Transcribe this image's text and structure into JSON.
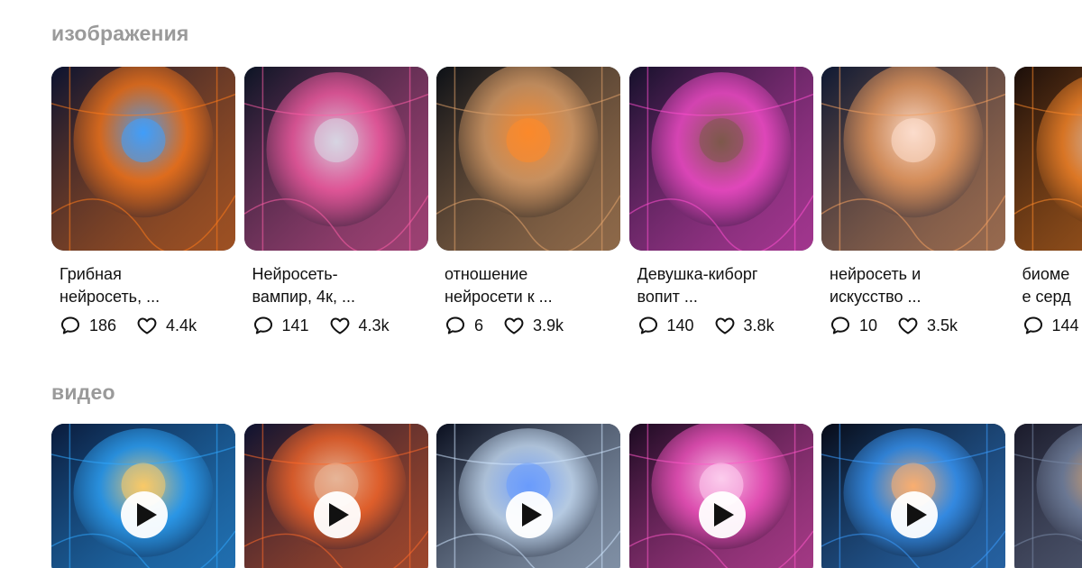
{
  "sections": {
    "images_title": "изображения",
    "videos_title": "видео"
  },
  "images": [
    {
      "title": "Грибная\nнейросеть, ...",
      "comments": "186",
      "likes": "4.4k",
      "palette": [
        "#0a1230",
        "#ff7a1a",
        "#3fa0ff"
      ]
    },
    {
      "title": "Нейросеть-\nвампир, 4к, ...",
      "comments": "141",
      "likes": "4.3k",
      "palette": [
        "#0b1424",
        "#ff5fa8",
        "#d9d9e6"
      ]
    },
    {
      "title": "отношение\nнейросети к ...",
      "comments": "6",
      "likes": "3.9k",
      "palette": [
        "#0c1016",
        "#e4a46b",
        "#ff8a2a"
      ]
    },
    {
      "title": "Девушка-киборг\nвопит ...",
      "comments": "140",
      "likes": "3.8k",
      "palette": [
        "#14102a",
        "#ff4fd0",
        "#7d5a4a"
      ]
    },
    {
      "title": "нейросеть и\nискусство ...",
      "comments": "10",
      "likes": "3.5k",
      "palette": [
        "#0d1833",
        "#f4a060",
        "#ffe0d0"
      ]
    },
    {
      "title": "биоме\nе серд",
      "comments": "144",
      "likes": "",
      "palette": [
        "#1a0e0a",
        "#ff8a2a",
        "#c8c8d0"
      ]
    }
  ],
  "videos": [
    {
      "palette": [
        "#0a1a3a",
        "#2fa8ff",
        "#ffcc66"
      ]
    },
    {
      "palette": [
        "#0d1230",
        "#ff6a2a",
        "#e9b89a"
      ]
    },
    {
      "palette": [
        "#0a0f1f",
        "#cfe6ff",
        "#6a9cff"
      ]
    },
    {
      "palette": [
        "#1a0a20",
        "#ff58c8",
        "#ffd0f0"
      ]
    },
    {
      "palette": [
        "#070a16",
        "#3a9cff",
        "#ffb070"
      ]
    },
    {
      "palette": [
        "#1a1a2a",
        "#7a8aa8",
        "#ffb060"
      ]
    }
  ],
  "icons": {
    "comment": "comment-icon",
    "like": "heart-icon",
    "play": "play-icon"
  }
}
